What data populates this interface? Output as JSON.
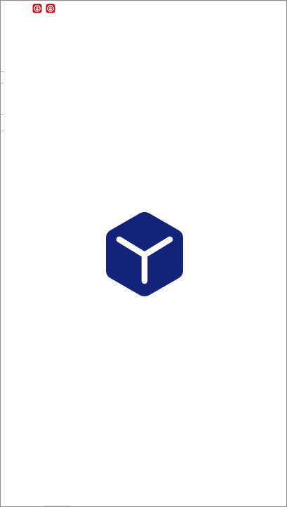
{
  "status_bar": {
    "icons": [
      "app-notification-icon",
      "app-notification-icon"
    ],
    "icon_color": "#c8101a"
  },
  "splash": {
    "logo_icon": "cube-logo-icon",
    "logo_color": "#14237a",
    "logo_mark_color": "#ffffff"
  },
  "colors": {
    "background": "#ffffff",
    "frame_border": "#8c8c8c"
  }
}
